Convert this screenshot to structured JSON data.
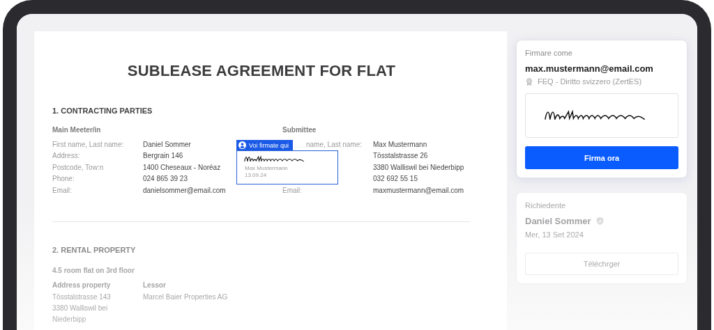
{
  "document": {
    "title": "SUBLEASE AGREEMENT FOR FLAT",
    "contracting": {
      "heading": "1. CONTRACTING PARTIES",
      "parties": [
        {
          "title": "Main Meeter/in",
          "rows": [
            {
              "label": "First name, Last name:",
              "value": "Daniel Sommer"
            },
            {
              "label": "Address:",
              "value": "Bergrain 146"
            },
            {
              "label": "Postcode, Tow:n",
              "value": "1400 Cheseaux - Noréaz"
            },
            {
              "label": "Phone:",
              "value": "024 865 39 23"
            },
            {
              "label": "Email:",
              "value": "danielsommer@email.com"
            }
          ]
        },
        {
          "title": "Submittee",
          "rows": [
            {
              "label": "name, Last name:",
              "value": "Max Mustermann"
            },
            {
              "value": "Tösstalstrasse 26"
            },
            {
              "value": "3380 Walliswil bei Niederbipp"
            },
            {
              "value": "032 692 55 15"
            },
            {
              "label": "Email:",
              "value": "maxmustermann@email.com"
            }
          ]
        }
      ]
    },
    "signature_field": {
      "badge": "Voi firmate qui",
      "name": "Max Mustermann",
      "date": "13.09.24"
    },
    "rental": {
      "heading": "2. RENTAL PROPERTY",
      "subtitle": "4.5 room flat on 3rd floor",
      "columns": [
        {
          "title": "Address property",
          "lines": [
            "Tösstalstrasse 143",
            "3380 Walliswil bei",
            "Niederbipp"
          ]
        },
        {
          "title": "Lessor",
          "lines": [
            "Marcel Baier Properties AG"
          ]
        }
      ]
    }
  },
  "sidebar": {
    "sign_card": {
      "label": "Firmare come",
      "email": "max.mustermann@email.com",
      "certificate": "FEQ - Diritto svizzero (ZertES)",
      "button": "Firma ora"
    },
    "requester_card": {
      "label": "Richiedente",
      "name": "Daniel Sommer",
      "verified": true,
      "date": "Mer, 13 Set 2024",
      "button": "Téléchrger"
    }
  }
}
